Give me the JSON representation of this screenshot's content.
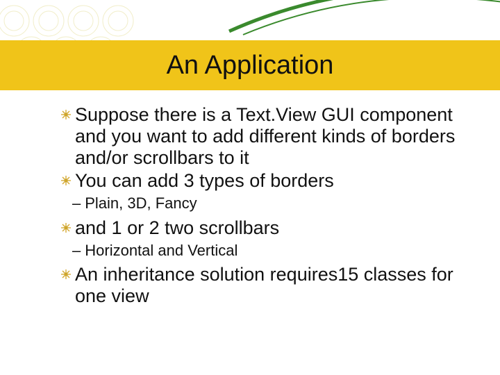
{
  "title": "An Application",
  "bullets": [
    {
      "text": "Suppose there is a Text.View GUI component and you want to add different kinds of borders and/or scrollbars to it"
    },
    {
      "text": "You can add 3 types of borders"
    },
    {
      "sub": "Plain, 3D, Fancy"
    },
    {
      "text": "and 1 or 2 two scrollbars"
    },
    {
      "sub": "Horizontal and Vertical"
    },
    {
      "text": "An inheritance solution requires15 classes for one view"
    }
  ]
}
